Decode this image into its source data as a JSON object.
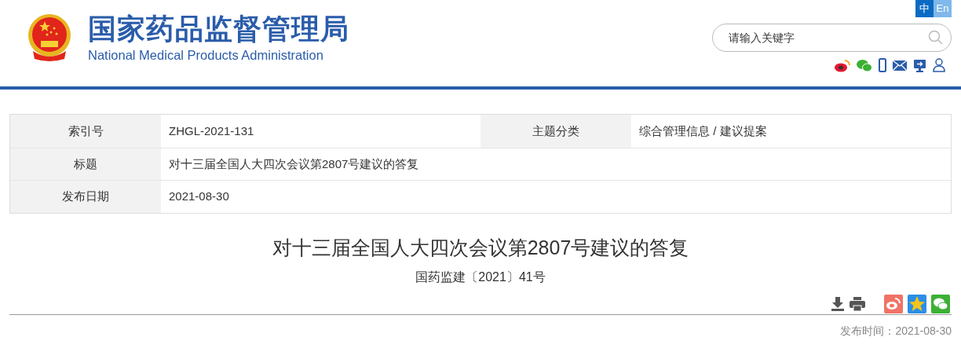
{
  "header": {
    "title": "国家药品监督管理局",
    "subtitle": "National Medical Products Administration"
  },
  "languages": [
    {
      "label": "中",
      "selected": true
    },
    {
      "label": "En",
      "selected": false
    }
  ],
  "search": {
    "placeholder": "请输入关键字"
  },
  "info_table": {
    "rows": [
      {
        "cells": [
          {
            "label": "索引号",
            "value": "ZHGL-2021-131"
          },
          {
            "label": "主题分类",
            "value": "综合管理信息 / 建议提案"
          }
        ]
      },
      {
        "cells": [
          {
            "label": "标题",
            "value": "对十三届全国人大四次会议第2807号建议的答复"
          }
        ]
      },
      {
        "cells": [
          {
            "label": "发布日期",
            "value": "2021-08-30"
          }
        ]
      }
    ]
  },
  "article": {
    "title": "对十三届全国人大四次会议第2807号建议的答复",
    "doc_number": "国药监建〔2021〕41号",
    "publish_time": "发布时间：2021-08-30"
  }
}
